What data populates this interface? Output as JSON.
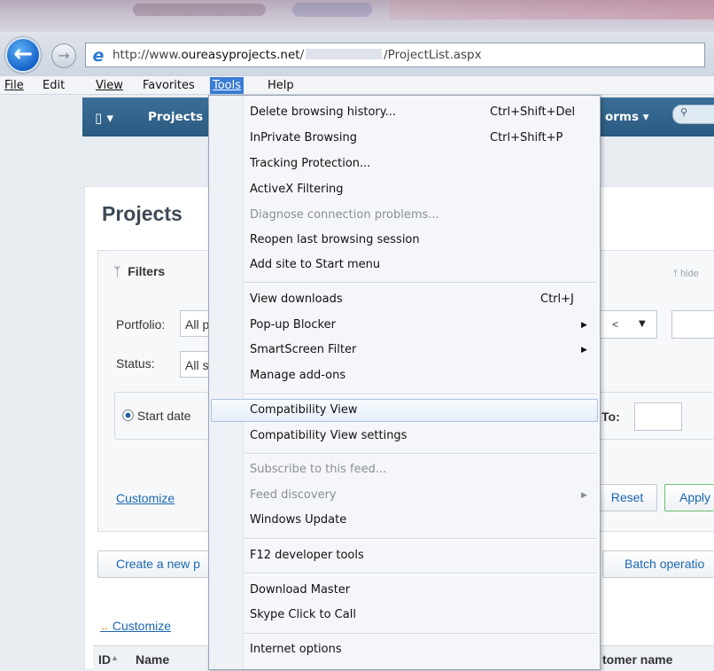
{
  "browser": {
    "url_prefix": "http://www.",
    "url_domain": "oureasyprojects.net",
    "url_mid": "/",
    "url_suffix": "/ProjectList.aspx",
    "menu": [
      "File",
      "Edit",
      "View",
      "Favorites",
      "Tools",
      "Help"
    ],
    "active_menu": "Tools"
  },
  "app_nav": {
    "menu_icon": "list-icon",
    "projects": "Projects",
    "forms": "orms"
  },
  "page": {
    "title": "Projects",
    "filters": {
      "title": "Filters",
      "hide": "hide",
      "portfolio_label": "Portfolio:",
      "portfolio_value": "All p",
      "status_label": "Status:",
      "status_value": "All s",
      "start_date_label": "Start date",
      "to_label": "To:",
      "compare_value": "<",
      "customize": "Customize",
      "reset": "Reset",
      "apply": "Apply"
    },
    "create_new": "Create a new p",
    "batch_operations": "Batch operatio",
    "list_customize": "Customize",
    "columns": [
      "ID",
      "Name",
      "tomer name"
    ]
  },
  "tools_menu": {
    "items": [
      {
        "label": "Delete browsing history...",
        "shortcut": "Ctrl+Shift+Del"
      },
      {
        "label": "InPrivate Browsing",
        "shortcut": "Ctrl+Shift+P"
      },
      {
        "label": "Tracking Protection..."
      },
      {
        "label": "ActiveX Filtering"
      },
      {
        "label": "Diagnose connection problems...",
        "disabled": true
      },
      {
        "label": "Reopen last browsing session"
      },
      {
        "label": "Add site to Start menu"
      },
      {
        "label": "View downloads",
        "shortcut": "Ctrl+J"
      },
      {
        "label": "Pop-up Blocker",
        "submenu": true
      },
      {
        "label": "SmartScreen Filter",
        "submenu": true
      },
      {
        "label": "Manage add-ons"
      },
      {
        "label": "Compatibility View",
        "highlighted": true
      },
      {
        "label": "Compatibility View settings"
      },
      {
        "label": "Subscribe to this feed...",
        "disabled": true
      },
      {
        "label": "Feed discovery",
        "disabled": true,
        "submenu": true
      },
      {
        "label": "Windows Update"
      },
      {
        "label": "F12 developer tools"
      },
      {
        "label": "Download Master"
      },
      {
        "label": "Skype Click to Call"
      },
      {
        "label": "Internet options"
      }
    ]
  },
  "colors": {
    "menu_active": "#3a7cd6",
    "app_nav": "#2f6088",
    "link": "#1a67b1"
  }
}
